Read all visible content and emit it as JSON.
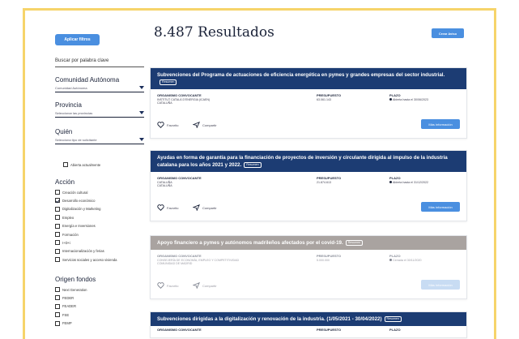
{
  "sidebar": {
    "apply_label": "Aplicar filtros",
    "search_placeholder": "Buscar por palabra clave",
    "filters": [
      {
        "title": "Comunidad Autónoma",
        "value": "Comunidad Autónoma"
      },
      {
        "title": "Provincia",
        "value": "Seleccionar las provincias"
      },
      {
        "title": "Quién",
        "value": "Selecciona tipo de solicitante"
      }
    ],
    "open_only_label": "Abierta actualmente",
    "accion_title": "Acción",
    "accion_items": [
      {
        "label": "Creación cultural",
        "checked": false
      },
      {
        "label": "Desarrollo económico",
        "checked": true
      },
      {
        "label": "Digitalización y Marketing",
        "checked": false
      },
      {
        "label": "Empleo",
        "checked": false
      },
      {
        "label": "Energía e Inversiones",
        "checked": false
      },
      {
        "label": "Formación",
        "checked": false
      },
      {
        "label": "I+D+i",
        "checked": false
      },
      {
        "label": "Internacionalización y ferias",
        "checked": false
      },
      {
        "label": "Servicios sociales y acceso vivienda",
        "checked": false
      }
    ],
    "origen_title": "Origen fondos",
    "origen_items": [
      {
        "label": "Next Generation",
        "checked": false
      },
      {
        "label": "FEDER",
        "checked": false
      },
      {
        "label": "FEADER",
        "checked": false
      },
      {
        "label": "FSE",
        "checked": false
      },
      {
        "label": "FEMP",
        "checked": false
      }
    ]
  },
  "main": {
    "results_title": "8.487 Resultados",
    "alert_label": "Crear Aviso",
    "labels": {
      "organismo": "ORGANISMO CONVOCANTE",
      "presupuesto": "PRESUPUESTO",
      "plazo": "PLAZO",
      "favorito": "Favorito",
      "compartir": "Compartir",
      "mas_info": "Más información",
      "badge": "Resumen"
    },
    "cards": [
      {
        "state": "active",
        "title": "Subvenciones del Programa de actuaciones de eficiencia energética en pymes y grandes empresas del sector industrial.",
        "organismo": "INSTITUT CATALÀ D'ENERGIA (ICAEN)",
        "region": "CATALUÑA",
        "presupuesto": "63.061.143",
        "plazo": "Abierta hasta el 30/06/2023"
      },
      {
        "state": "active",
        "title": "Ayudas en forma de garantía para la financiación de proyectos de inversión y circulante dirigida al impulso de la industria catalana para los años 2021 y 2022.",
        "organismo": "CATALUÑA",
        "region": "CATALUÑA",
        "presupuesto": "21.874.613",
        "plazo": "Abierta hasta el 31/12/2022"
      },
      {
        "state": "closed",
        "title": "Apoyo financiero a pymes y autónomos madrileños afectados por el covid-19.",
        "organismo": "CONSEJERÍA DE ECONOMÍA, EMPLEO Y COMPETITIVIDAD",
        "region": "COMUNIDAD DE MADRID",
        "presupuesto": "5.000.000",
        "plazo": "Cerrada el 30/11/2020"
      },
      {
        "state": "active",
        "title": "Subvenciones dirigidas a la digitalización y renovación de la industria. (1/05/2021 - 30/04/2022)",
        "organismo": "",
        "region": "",
        "presupuesto": "",
        "plazo": ""
      }
    ]
  },
  "colors": {
    "header_active": "#1c3c73",
    "header_closed": "#a9a3a0",
    "button_blue": "#4a8fe0",
    "frame_border": "#f6d46a"
  }
}
